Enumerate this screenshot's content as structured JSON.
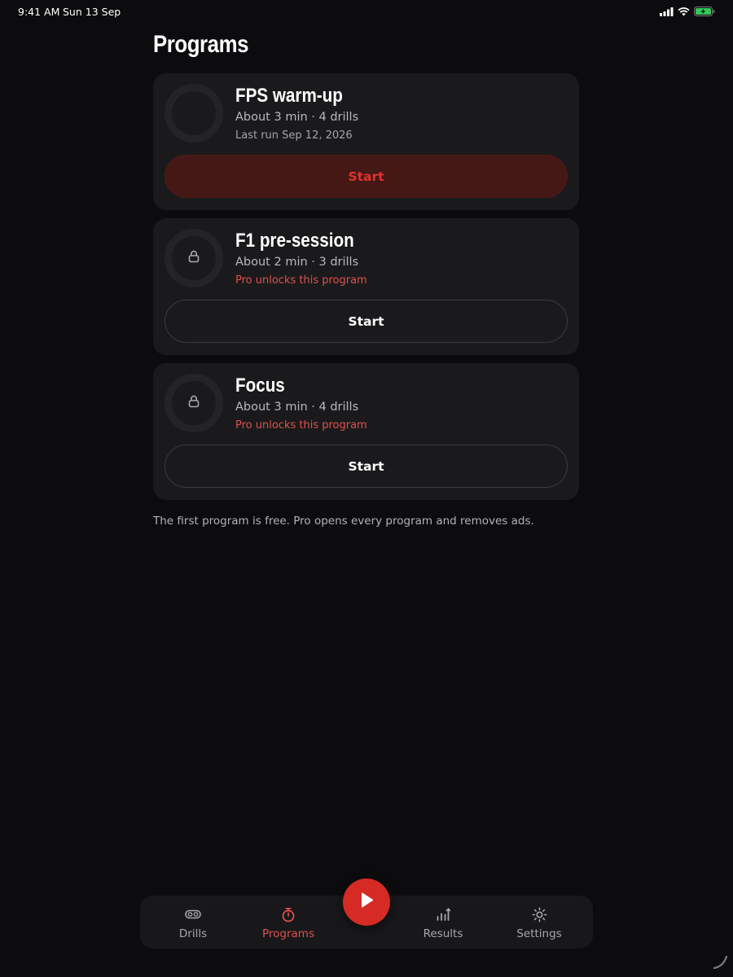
{
  "status": {
    "time": "9:41 AM",
    "date": "Sun 13 Sep"
  },
  "page": {
    "title": "Programs"
  },
  "programs": [
    {
      "title": "FPS warm-up",
      "meta": "About 3 min · 4 drills",
      "sub": "Last run Sep 12, 2026",
      "start_label": "Start",
      "locked": false
    },
    {
      "title": "F1 pre-session",
      "meta": "About 2 min · 3 drills",
      "sub": "Pro unlocks this program",
      "start_label": "Start",
      "locked": true
    },
    {
      "title": "Focus",
      "meta": "About 3 min · 4 drills",
      "sub": "Pro unlocks this program",
      "start_label": "Start",
      "locked": true
    }
  ],
  "footnote": "The first program is free. Pro opens every program and removes ads.",
  "tabs": [
    {
      "label": "Drills",
      "icon": "link-icon",
      "active": false
    },
    {
      "label": "Programs",
      "icon": "stopwatch-icon",
      "active": true
    },
    {
      "label": "Results",
      "icon": "bar-chart-icon",
      "active": false
    },
    {
      "label": "Settings",
      "icon": "gear-icon",
      "active": false
    }
  ],
  "colors": {
    "accent": "#e2332d",
    "accent_soft": "#e0514c",
    "background": "#0c0c0e",
    "card": "#1a1a1c"
  }
}
